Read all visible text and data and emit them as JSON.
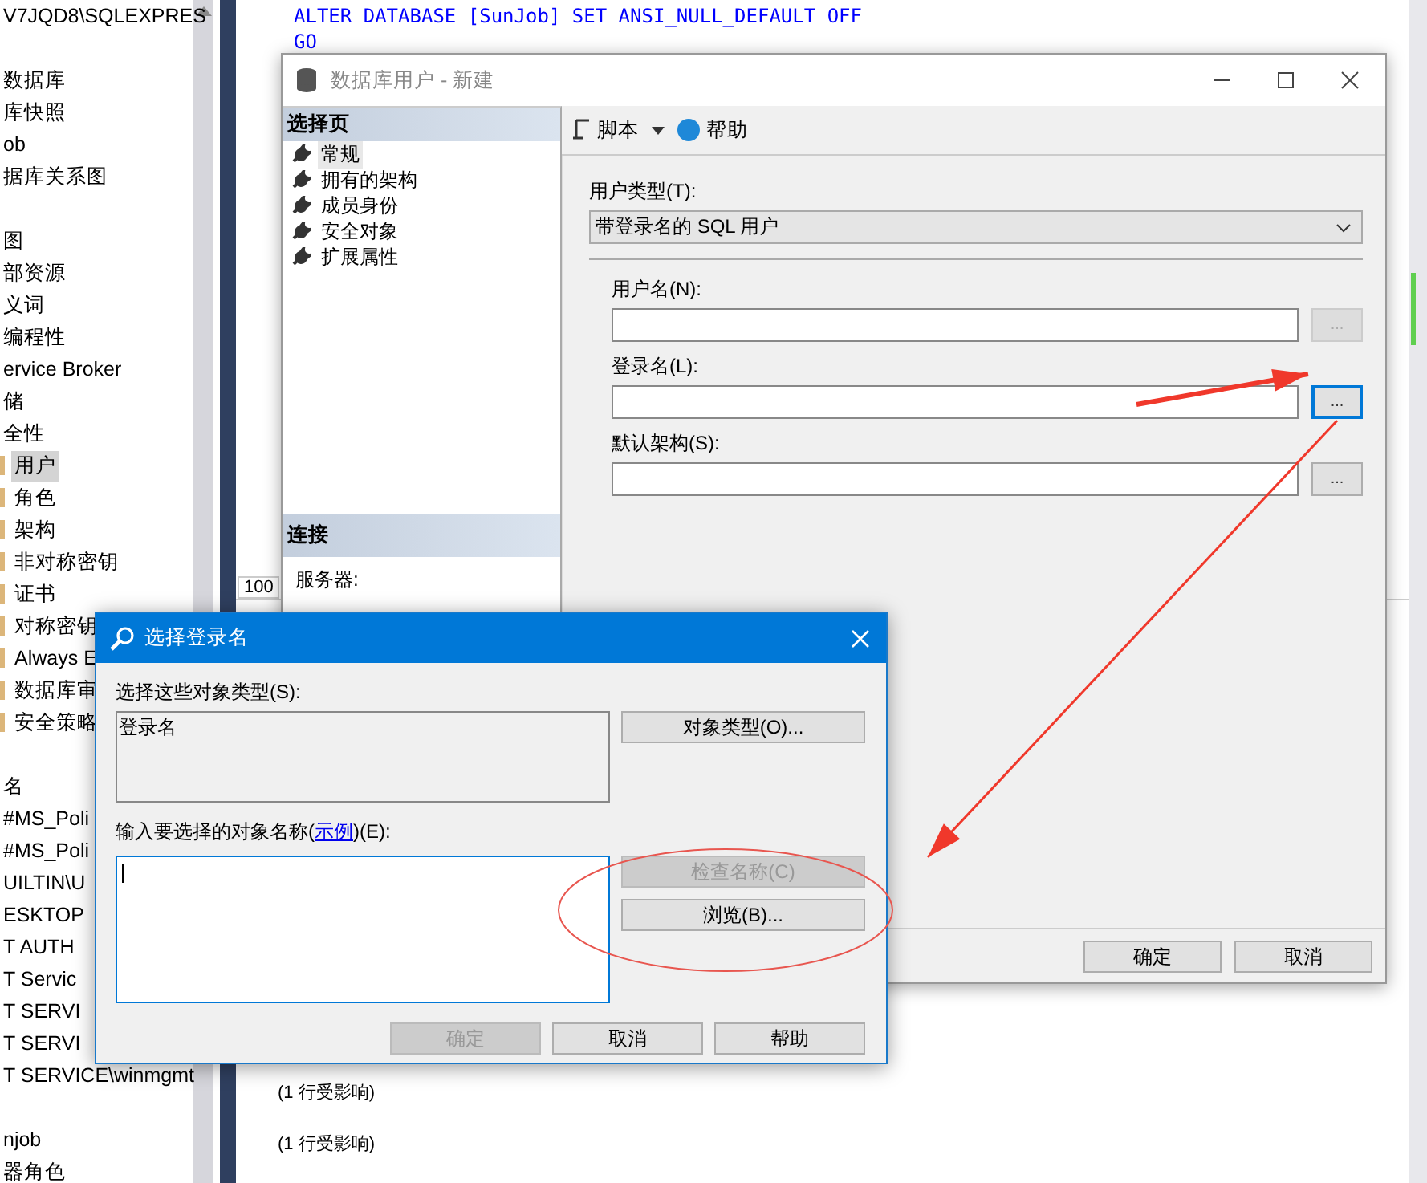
{
  "object_explorer": {
    "items": [
      {
        "label": "V7JQD8\\SQLEXPRES",
        "selected": false
      },
      {
        "label": "数据库",
        "selected": false,
        "gap_before": true
      },
      {
        "label": "库快照",
        "selected": false
      },
      {
        "label": "ob",
        "selected": false
      },
      {
        "label": "据库关系图",
        "selected": false
      },
      {
        "label": "图",
        "selected": false,
        "gap_before": true
      },
      {
        "label": "部资源",
        "selected": false
      },
      {
        "label": "义词",
        "selected": false
      },
      {
        "label": "编程性",
        "selected": false
      },
      {
        "label": "ervice Broker",
        "selected": false
      },
      {
        "label": "储",
        "selected": false
      },
      {
        "label": "全性",
        "selected": false
      },
      {
        "label": "用户",
        "selected": true,
        "folder": true
      },
      {
        "label": "角色",
        "selected": false,
        "folder": true
      },
      {
        "label": "架构",
        "selected": false,
        "folder": true
      },
      {
        "label": "非对称密钥",
        "selected": false,
        "folder": true
      },
      {
        "label": "证书",
        "selected": false,
        "folder": true
      },
      {
        "label": "对称密钥",
        "selected": false,
        "folder": true
      },
      {
        "label": "Always E",
        "selected": false,
        "folder": true
      },
      {
        "label": "数据库审",
        "selected": false,
        "folder": true
      },
      {
        "label": "安全策略",
        "selected": false,
        "folder": true
      },
      {
        "label": "名",
        "selected": false,
        "gap_before": true
      },
      {
        "label": "#MS_Poli",
        "selected": false
      },
      {
        "label": "#MS_Poli",
        "selected": false
      },
      {
        "label": "UILTIN\\U",
        "selected": false
      },
      {
        "label": "ESKTOP",
        "selected": false
      },
      {
        "label": "T AUTH",
        "selected": false
      },
      {
        "label": "T Servic",
        "selected": false
      },
      {
        "label": "T SERVI",
        "selected": false
      },
      {
        "label": "T SERVI",
        "selected": false
      },
      {
        "label": "T SERVICE\\winmgmt",
        "selected": false
      },
      {
        "label": "njob",
        "selected": false,
        "gap_before": true
      },
      {
        "label": "器角色",
        "selected": false
      }
    ]
  },
  "editor": {
    "code_lines": [
      "ALTER DATABASE [SunJob] SET ANSI_NULL_DEFAULT OFF",
      "GO"
    ],
    "zoom": "100",
    "messages": [
      "(1  行受影响)",
      "(1  行受影响)"
    ]
  },
  "user_dialog": {
    "title": "数据库用户 - 新建",
    "pages_header": "选择页",
    "pages": [
      {
        "label": "常规",
        "selected": true
      },
      {
        "label": "拥有的架构",
        "selected": false
      },
      {
        "label": "成员身份",
        "selected": false
      },
      {
        "label": "安全对象",
        "selected": false
      },
      {
        "label": "扩展属性",
        "selected": false
      }
    ],
    "connection_header": "连接",
    "server_label": "服务器:",
    "toolbar": {
      "script": "脚本",
      "help": "帮助"
    },
    "user_type_label": "用户类型(T):",
    "user_type_value": "带登录名的 SQL 用户",
    "fields": [
      {
        "label": "用户名(N):",
        "button": "...",
        "disabled": true,
        "focused": false
      },
      {
        "label": "登录名(L):",
        "button": "...",
        "disabled": false,
        "focused": true
      },
      {
        "label": "默认架构(S):",
        "button": "...",
        "disabled": false,
        "focused": false
      }
    ],
    "buttons": [
      "确定",
      "取消"
    ]
  },
  "login_dialog": {
    "title": "选择登录名",
    "types_label": "选择这些对象类型(S):",
    "types_value": "登录名",
    "types_button": "对象类型(O)...",
    "names_label_before": "输入要选择的对象名称(",
    "names_link": "示例",
    "names_label_after": ")(E):",
    "side_buttons": [
      {
        "label": "检查名称(C)",
        "disabled": true
      },
      {
        "label": "浏览(B)...",
        "disabled": false
      }
    ],
    "buttons": [
      {
        "label": "确定",
        "disabled": true
      },
      {
        "label": "取消",
        "disabled": false
      },
      {
        "label": "帮助",
        "disabled": false
      }
    ]
  },
  "annotations": [
    {
      "kind": "arrow"
    },
    {
      "kind": "arrow"
    },
    {
      "kind": "ellipse"
    }
  ]
}
